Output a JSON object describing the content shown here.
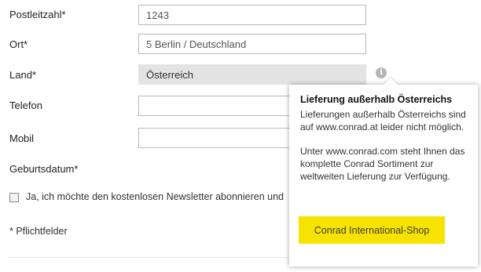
{
  "form": {
    "postcode": {
      "label": "Postleitzahl*",
      "value": "1243"
    },
    "city": {
      "label": "Ort*",
      "value": "5 Berlin / Deutschland"
    },
    "country": {
      "label": "Land*",
      "value": "Österreich"
    },
    "phone": {
      "label": "Telefon",
      "value": ""
    },
    "mobile": {
      "label": "Mobil",
      "value": ""
    },
    "birthdate": {
      "label": "Geburtsdatum*"
    },
    "newsletter": {
      "label": "Ja, ich möchte den kostenlosen Newsletter abonnieren und",
      "checked": false
    },
    "required_note": "* Pflichtfelder"
  },
  "tooltip": {
    "title": "Lieferung außerhalb Österreichs",
    "text1": "Lieferungen außerhalb Österreichs sind auf www.conrad.at leider nicht möglich.",
    "text2": "Unter www.conrad.com steht Ihnen das komplette Conrad Sortiment zur weltweiten Lieferung zur Verfügung.",
    "button_label": "Conrad International-Shop"
  },
  "icons": {
    "info": "info-icon"
  },
  "colors": {
    "accent": "#f7e300",
    "select_bg": "#e3e3e3",
    "info_icon": "#b3b3b3"
  }
}
